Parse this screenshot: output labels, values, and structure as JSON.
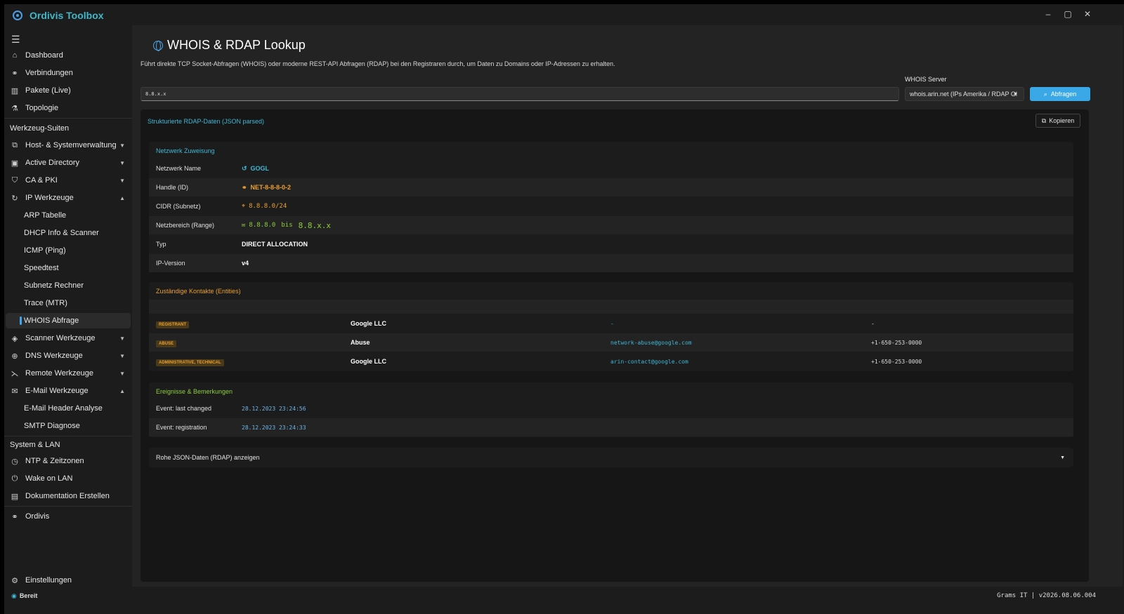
{
  "app": {
    "title": "Ordivis Toolbox"
  },
  "window_controls": {
    "minimize": "–",
    "maximize": "▢",
    "close": "✕"
  },
  "sidebar": {
    "menu_icon": "☰",
    "top_items": [
      "Dashboard",
      "Verbindungen",
      "Pakete (Live)",
      "Topologie"
    ],
    "section_tools": "Werkzeug-Suiten",
    "tool_groups": [
      "Host- & Systemverwaltung",
      "Active Directory",
      "CA & PKI",
      "IP Werkzeuge"
    ],
    "ip_sub": [
      "ARP Tabelle",
      "DHCP Info & Scanner",
      "ICMP (Ping)",
      "Speedtest",
      "Subnetz Rechner",
      "Trace (MTR)",
      "WHOIS Abfrage"
    ],
    "more_groups": [
      "Scanner Werkzeuge",
      "DNS Werkzeuge",
      "Remote Werkzeuge",
      "E-Mail Werkzeuge"
    ],
    "mail_sub": [
      "E-Mail Header Analyse",
      "SMTP Diagnose"
    ],
    "section_system": "System & LAN",
    "system_items": [
      "NTP & Zeitzonen",
      "Wake on LAN",
      "Dokumentation Erstellen"
    ],
    "ordivis": "Ordivis",
    "settings": "Einstellungen"
  },
  "page": {
    "title": "WHOIS & RDAP Lookup",
    "description": "Führt direkte TCP Socket-Abfragen (WHOIS) oder moderne REST-API Abfragen (RDAP) bei den Registraren durch, um Daten zu Domains oder IP-Adressen zu erhalten.",
    "query_value": "8.8.x.x",
    "server_label": "WHOIS Server",
    "server_value": "whois.arin.net (IPs Amerika / RDAP Gl",
    "query_button": "Abfragen"
  },
  "result": {
    "title": "Strukturierte RDAP-Daten (JSON parsed)",
    "copy_button": "Kopieren",
    "network": {
      "title": "Netzwerk Zuweisung",
      "rows": [
        {
          "label": "Netzwerk Name",
          "value": "GOGL"
        },
        {
          "label": "Handle (ID)",
          "value": "NET-8-8-8-0-2"
        },
        {
          "label": "CIDR (Subnetz)",
          "value": "8.8.8.0/24"
        },
        {
          "label": "Netzbereich (Range)",
          "from": "8.8.8.0",
          "sep": "bis",
          "to": "8.8.x.x"
        },
        {
          "label": "Typ",
          "value": "DIRECT ALLOCATION"
        },
        {
          "label": "IP-Version",
          "value": "v4"
        }
      ]
    },
    "entities": {
      "title": "Zuständige Kontakte (Entities)",
      "rows": [
        {
          "role": "REGISTRANT",
          "name": "Google LLC",
          "email": "-",
          "phone": "-"
        },
        {
          "role": "ABUSE",
          "name": "Abuse",
          "email": "network-abuse@google.com",
          "phone": "+1-650-253-0000"
        },
        {
          "role": "ADMINISTRATIVE, TECHNICAL",
          "name": "Google LLC",
          "email": "arin-contact@google.com",
          "phone": "+1-650-253-0000"
        }
      ]
    },
    "events": {
      "title": "Ereignisse & Bemerkungen",
      "rows": [
        {
          "label": "Event: last changed",
          "value": "28.12.2023 23:24:56"
        },
        {
          "label": "Event: registration",
          "value": "28.12.2023 23:24:33"
        }
      ]
    },
    "raw_toggle": "Rohe JSON-Daten (RDAP) anzeigen"
  },
  "status": {
    "state": "Bereit",
    "version": "Grams IT | v2026.08.06.004"
  },
  "colors": {
    "accent": "#3aa8e6",
    "cyan": "#3fb8d6",
    "orange": "#e8a02e",
    "green": "#8ecf3a"
  }
}
